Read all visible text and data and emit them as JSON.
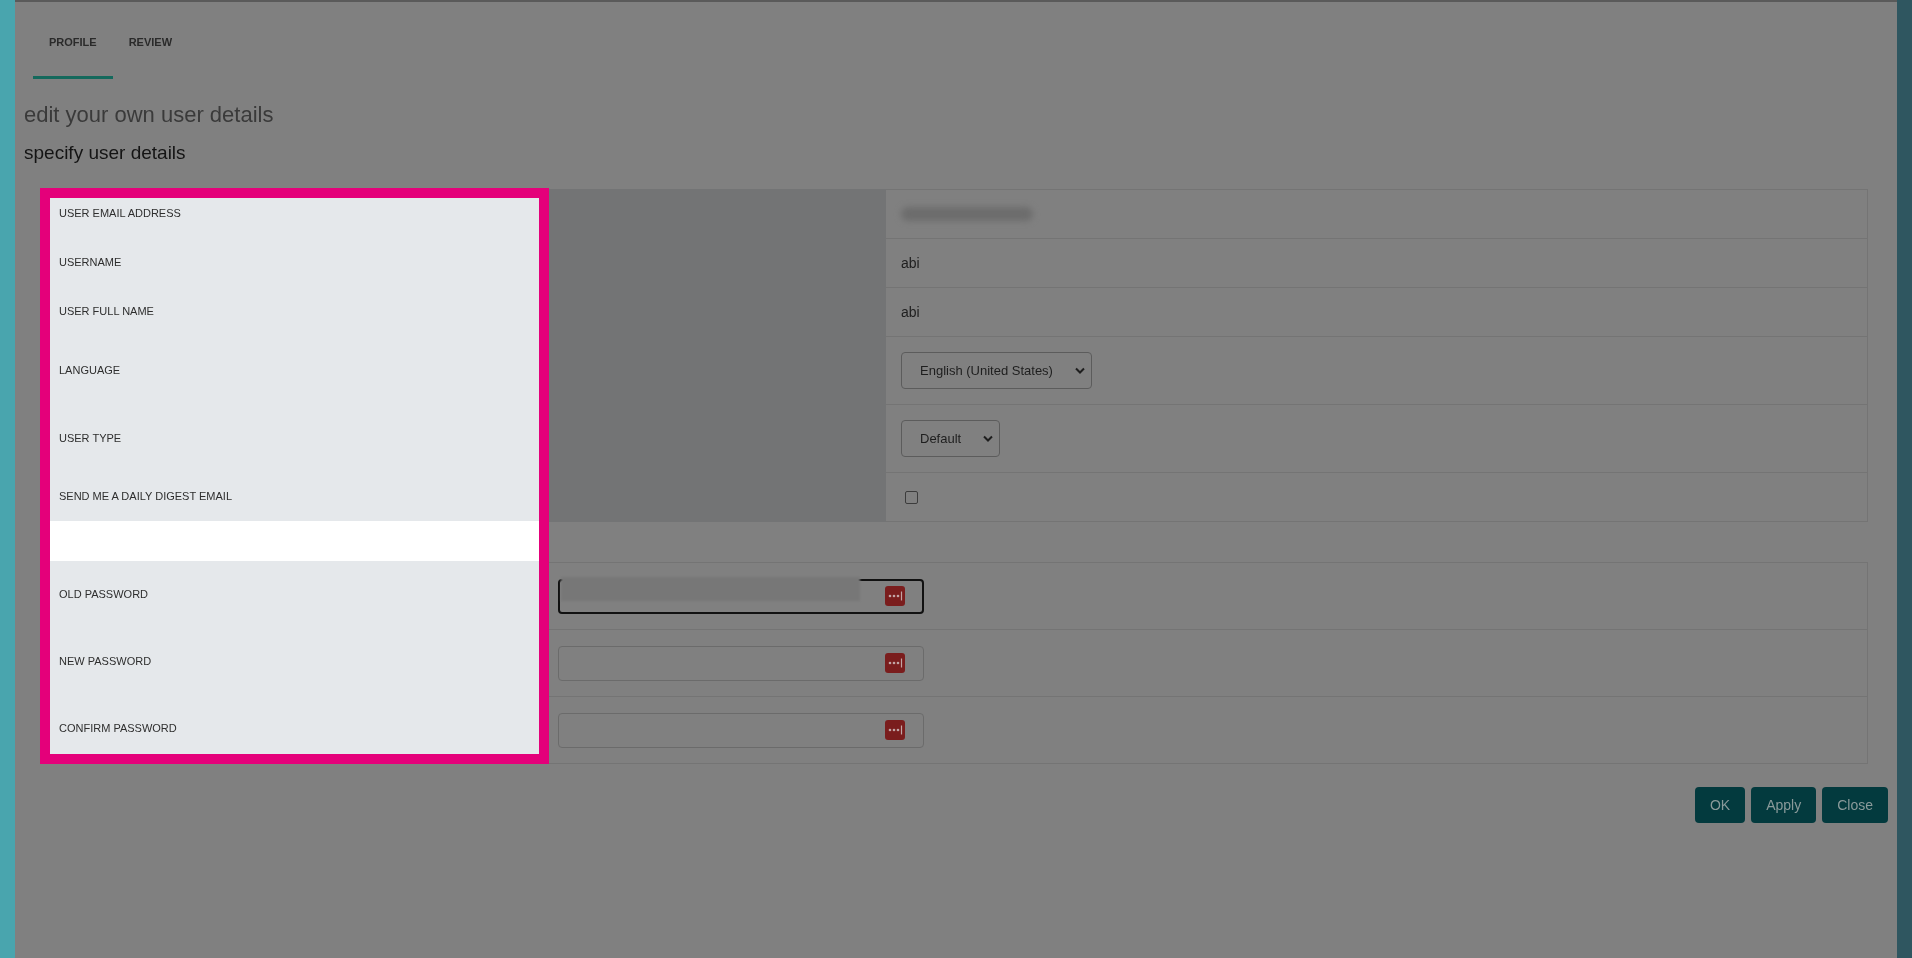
{
  "tabs": [
    {
      "label": "PROFILE",
      "selected": true
    },
    {
      "label": "REVIEW",
      "selected": false
    }
  ],
  "heading": "edit your own user details",
  "subheading": "specify user details",
  "label_column_highlighted": true,
  "user_details": {
    "rows": [
      {
        "kind": "redacted",
        "label": "USER EMAIL ADDRESS"
      },
      {
        "kind": "text",
        "label": "USERNAME",
        "value": "abi"
      },
      {
        "kind": "text",
        "label": "USER FULL NAME",
        "value": "abi"
      },
      {
        "kind": "select",
        "label": "LANGUAGE",
        "value": "English (United States)"
      },
      {
        "kind": "select",
        "label": "USER TYPE",
        "value": "Default"
      },
      {
        "kind": "checkbox",
        "label": "SEND ME A DAILY DIGEST EMAIL",
        "checked": false
      }
    ]
  },
  "password": {
    "rows": [
      {
        "label": "OLD PASSWORD",
        "focused": true,
        "redacted": true
      },
      {
        "label": "NEW PASSWORD",
        "focused": false,
        "redacted": false
      },
      {
        "label": "CONFIRM PASSWORD",
        "focused": false,
        "redacted": false
      }
    ]
  },
  "buttons": [
    "OK",
    "Apply",
    "Close"
  ]
}
